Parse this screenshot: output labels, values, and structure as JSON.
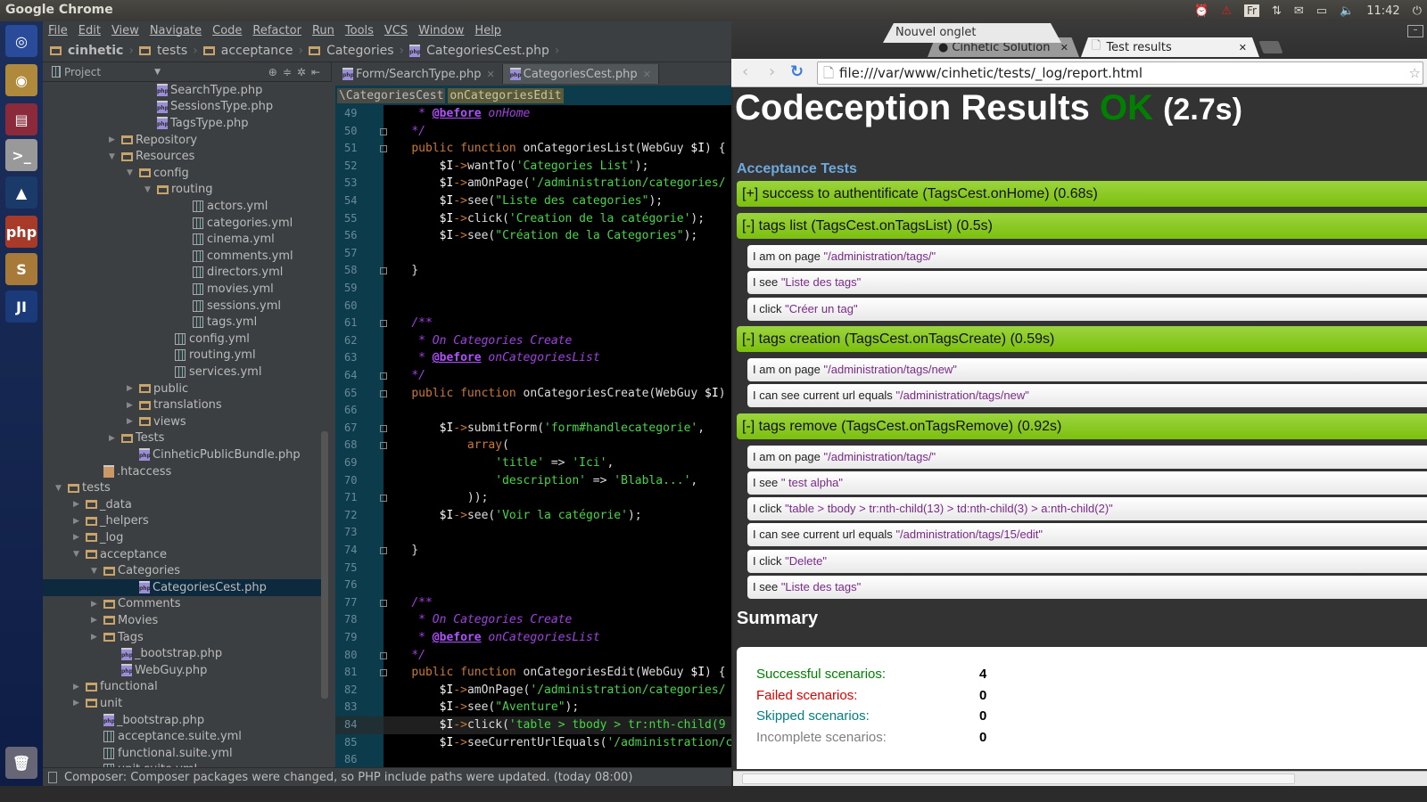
{
  "system": {
    "active_app": "Google Chrome",
    "tray": {
      "keyboard": "Fr",
      "time": "11:42"
    }
  },
  "launcher": {
    "items": [
      {
        "name": "ubuntu-dash",
        "glyph": "◎",
        "color": "#2a4a9a"
      },
      {
        "name": "chrome",
        "glyph": "◉",
        "color": "#b08a3c"
      },
      {
        "name": "file-manager",
        "glyph": "▤",
        "color": "#8a2a3a"
      },
      {
        "name": "terminal",
        "glyph": ">_",
        "color": "#999"
      },
      {
        "name": "inkscape",
        "glyph": "▲",
        "color": "#1a3a6a"
      },
      {
        "name": "phpstorm",
        "glyph": "php",
        "color": "#a83a2a"
      },
      {
        "name": "sublime-text",
        "glyph": "S",
        "color": "#a87a3a"
      },
      {
        "name": "jetbrains",
        "glyph": "JI",
        "color": "#1a3a7a"
      }
    ]
  },
  "ide": {
    "menu": [
      "File",
      "Edit",
      "View",
      "Navigate",
      "Code",
      "Refactor",
      "Run",
      "Tools",
      "VCS",
      "Window",
      "Help"
    ],
    "breadcrumb": [
      "cinhetic",
      "tests",
      "acceptance",
      "Categories",
      "CategoriesCest.php"
    ],
    "project_label": "Project",
    "tree": [
      {
        "label": "SearchType.php",
        "depth": 6,
        "type": "php"
      },
      {
        "label": "SessionsType.php",
        "depth": 6,
        "type": "php"
      },
      {
        "label": "TagsType.php",
        "depth": 6,
        "type": "php"
      },
      {
        "label": "Repository",
        "depth": 4,
        "type": "folder",
        "arrow": "right"
      },
      {
        "label": "Resources",
        "depth": 4,
        "type": "folder",
        "arrow": "down"
      },
      {
        "label": "config",
        "depth": 5,
        "type": "folder",
        "arrow": "down"
      },
      {
        "label": "routing",
        "depth": 6,
        "type": "folder",
        "arrow": "down"
      },
      {
        "label": "actors.yml",
        "depth": 8,
        "type": "yml"
      },
      {
        "label": "categories.yml",
        "depth": 8,
        "type": "yml"
      },
      {
        "label": "cinema.yml",
        "depth": 8,
        "type": "yml"
      },
      {
        "label": "comments.yml",
        "depth": 8,
        "type": "yml"
      },
      {
        "label": "directors.yml",
        "depth": 8,
        "type": "yml"
      },
      {
        "label": "movies.yml",
        "depth": 8,
        "type": "yml"
      },
      {
        "label": "sessions.yml",
        "depth": 8,
        "type": "yml"
      },
      {
        "label": "tags.yml",
        "depth": 8,
        "type": "yml"
      },
      {
        "label": "config.yml",
        "depth": 7,
        "type": "yml"
      },
      {
        "label": "routing.yml",
        "depth": 7,
        "type": "yml"
      },
      {
        "label": "services.yml",
        "depth": 7,
        "type": "yml"
      },
      {
        "label": "public",
        "depth": 5,
        "type": "folder",
        "arrow": "right"
      },
      {
        "label": "translations",
        "depth": 5,
        "type": "folder",
        "arrow": "right"
      },
      {
        "label": "views",
        "depth": 5,
        "type": "folder",
        "arrow": "right"
      },
      {
        "label": "Tests",
        "depth": 4,
        "type": "folder",
        "arrow": "right"
      },
      {
        "label": "CinheticPublicBundle.php",
        "depth": 5,
        "type": "php"
      },
      {
        "label": ".htaccess",
        "depth": 3,
        "type": "file"
      },
      {
        "label": "tests",
        "depth": 1,
        "type": "folder",
        "arrow": "down"
      },
      {
        "label": "_data",
        "depth": 2,
        "type": "folder",
        "arrow": "right"
      },
      {
        "label": "_helpers",
        "depth": 2,
        "type": "folder",
        "arrow": "right"
      },
      {
        "label": "_log",
        "depth": 2,
        "type": "folder",
        "arrow": "right"
      },
      {
        "label": "acceptance",
        "depth": 2,
        "type": "folder",
        "arrow": "down"
      },
      {
        "label": "Categories",
        "depth": 3,
        "type": "folder",
        "arrow": "down"
      },
      {
        "label": "CategoriesCest.php",
        "depth": 5,
        "type": "php",
        "selected": true
      },
      {
        "label": "Comments",
        "depth": 3,
        "type": "folder",
        "arrow": "right"
      },
      {
        "label": "Movies",
        "depth": 3,
        "type": "folder",
        "arrow": "right"
      },
      {
        "label": "Tags",
        "depth": 3,
        "type": "folder",
        "arrow": "right"
      },
      {
        "label": "_bootstrap.php",
        "depth": 4,
        "type": "php"
      },
      {
        "label": "WebGuy.php",
        "depth": 4,
        "type": "php"
      },
      {
        "label": "functional",
        "depth": 2,
        "type": "folder",
        "arrow": "right"
      },
      {
        "label": "unit",
        "depth": 2,
        "type": "folder",
        "arrow": "right"
      },
      {
        "label": "_bootstrap.php",
        "depth": 3,
        "type": "php"
      },
      {
        "label": "acceptance.suite.yml",
        "depth": 3,
        "type": "yml"
      },
      {
        "label": "functional.suite.yml",
        "depth": 3,
        "type": "yml"
      },
      {
        "label": "unit.suite.yml",
        "depth": 3,
        "type": "yml"
      }
    ],
    "editor_tabs": [
      {
        "label": "Form/SearchType.php",
        "active": false
      },
      {
        "label": "CategoriesCest.php",
        "active": true
      }
    ],
    "code_breadcrumb": [
      "\\CategoriesCest",
      "onCategoriesEdit"
    ],
    "code_lines": [
      {
        "n": 49,
        "html": "     <span class='cm'>* </span><span class='tag'>@before</span><span class='cm'> onHome</span>"
      },
      {
        "n": 50,
        "html": "    <span class='cm'>*/</span>"
      },
      {
        "n": 51,
        "html": "    <span class='kw'>public function</span> onCategoriesList(WebGuy <span class='var'>$I</span>) {"
      },
      {
        "n": 52,
        "html": "        <span class='var'>$I</span><span class='arr'>-&gt;</span>wantTo(<span class='str'>'Categories List'</span>);"
      },
      {
        "n": 53,
        "html": "        <span class='var'>$I</span><span class='arr'>-&gt;</span>amOnPage(<span class='str'>'/administration/categories/</span>"
      },
      {
        "n": 54,
        "html": "        <span class='var'>$I</span><span class='arr'>-&gt;</span>see(<span class='str'>\"Liste des categories\"</span>);"
      },
      {
        "n": 55,
        "html": "        <span class='var'>$I</span><span class='arr'>-&gt;</span>click(<span class='str'>'Creation de la catégorie'</span>);"
      },
      {
        "n": 56,
        "html": "        <span class='var'>$I</span><span class='arr'>-&gt;</span>see(<span class='str'>\"Création de la Categories\"</span>);"
      },
      {
        "n": 57,
        "html": ""
      },
      {
        "n": 58,
        "html": "    }"
      },
      {
        "n": 59,
        "html": ""
      },
      {
        "n": 60,
        "html": ""
      },
      {
        "n": 61,
        "html": "    <span class='cm'>/**</span>"
      },
      {
        "n": 62,
        "html": "     <span class='cm'>* On Categories Create</span>"
      },
      {
        "n": 63,
        "html": "     <span class='cm'>* </span><span class='tag'>@before</span><span class='cm'> onCategoriesList</span>"
      },
      {
        "n": 64,
        "html": "    <span class='cm'>*/</span>"
      },
      {
        "n": 65,
        "html": "    <span class='kw'>public function</span> onCategoriesCreate(WebGuy <span class='var'>$I</span>)"
      },
      {
        "n": 66,
        "html": ""
      },
      {
        "n": 67,
        "html": "        <span class='var'>$I</span><span class='arr'>-&gt;</span>submitForm(<span class='str'>'form#handlecategorie'</span>,"
      },
      {
        "n": 68,
        "html": "            <span class='kw'>array</span>("
      },
      {
        "n": 69,
        "html": "                <span class='str'>'title'</span> =&gt; <span class='str'>'Ici'</span>,"
      },
      {
        "n": 70,
        "html": "                <span class='str'>'description'</span> =&gt; <span class='str'>'Blabla...'</span>,"
      },
      {
        "n": 71,
        "html": "            ));"
      },
      {
        "n": 72,
        "html": "        <span class='var'>$I</span><span class='arr'>-&gt;</span>see(<span class='str'>'Voir la catégorie'</span>);"
      },
      {
        "n": 73,
        "html": ""
      },
      {
        "n": 74,
        "html": "    }"
      },
      {
        "n": 75,
        "html": ""
      },
      {
        "n": 76,
        "html": ""
      },
      {
        "n": 77,
        "html": "    <span class='cm'>/**</span>"
      },
      {
        "n": 78,
        "html": "     <span class='cm'>* On Categories Create</span>"
      },
      {
        "n": 79,
        "html": "     <span class='cm'>* </span><span class='tag'>@before</span><span class='cm'> onCategoriesList</span>"
      },
      {
        "n": 80,
        "html": "    <span class='cm'>*/</span>"
      },
      {
        "n": 81,
        "html": "    <span class='kw'>public function</span> onCategoriesEdit(WebGuy <span class='var'>$I</span>) {"
      },
      {
        "n": 82,
        "html": "        <span class='var'>$I</span><span class='arr'>-&gt;</span>amOnPage(<span class='str'>'/administration/categories/</span>"
      },
      {
        "n": 83,
        "html": "        <span class='var'>$I</span><span class='arr'>-&gt;</span>see(<span class='str'>\"Aventure\"</span>);"
      },
      {
        "n": 84,
        "html": "        <span class='var'>$I</span><span class='arr'>-&gt;</span>click(<span class='str'>'table &gt; tbody &gt; tr:nth-child(9</span>",
        "current": true
      },
      {
        "n": 85,
        "html": "        <span class='var'>$I</span><span class='arr'>-&gt;</span>seeCurrentUrlEquals(<span class='str'>'/administration/c</span>"
      },
      {
        "n": 86,
        "html": ""
      }
    ],
    "status_message": "Composer: Composer packages were changed, so PHP include paths were updated. (today 08:00)"
  },
  "browser": {
    "tabs": [
      {
        "label": "Cinhetic Solution",
        "active": false
      },
      {
        "label": "Test results",
        "active": true
      }
    ],
    "new_tab_tooltip": "Nouvel onglet",
    "url": "file:///var/www/cinhetic/tests/_log/report.html",
    "report": {
      "title": "Codeception Results",
      "status": "OK",
      "duration": "(2.7s)",
      "suite": "Acceptance Tests",
      "scenarios": [
        {
          "label": "[+] success to authentificate (TagsCest.onHome) (0.68s)",
          "steps": []
        },
        {
          "label": "[-] tags list (TagsCest.onTagsList) (0.5s)",
          "steps": [
            {
              "action": "I am on page",
              "arg": "\"/administration/tags/\""
            },
            {
              "action": "I see",
              "arg": "\"Liste des tags\""
            },
            {
              "action": "I click",
              "arg": "\"Créer un tag\""
            }
          ]
        },
        {
          "label": "[-] tags creation (TagsCest.onTagsCreate) (0.59s)",
          "steps": [
            {
              "action": "I am on page",
              "arg": "\"/administration/tags/new\""
            },
            {
              "action": "I can see current url equals",
              "arg": "\"/administration/tags/new\""
            }
          ]
        },
        {
          "label": "[-] tags remove (TagsCest.onTagsRemove) (0.92s)",
          "steps": [
            {
              "action": "I am on page",
              "arg": "\"/administration/tags/\""
            },
            {
              "action": "I see",
              "arg": "\" test alpha\""
            },
            {
              "action": "I click",
              "arg": "\"table > tbody > tr:nth-child(13) > td:nth-child(3) > a:nth-child(2)\""
            },
            {
              "action": "I can see current url equals",
              "arg": "\"/administration/tags/15/edit\""
            },
            {
              "action": "I click",
              "arg": "\"Delete\""
            },
            {
              "action": "I see",
              "arg": "\"Liste des tags\""
            }
          ]
        }
      ],
      "summary_title": "Summary",
      "summary": [
        {
          "label": "Successful scenarios:",
          "value": "4",
          "color": "#008000"
        },
        {
          "label": "Failed scenarios:",
          "value": "0",
          "color": "#e00000"
        },
        {
          "label": "Skipped scenarios:",
          "value": "0",
          "color": "#008080"
        },
        {
          "label": "Incomplete scenarios:",
          "value": "0",
          "color": "#808080"
        }
      ]
    }
  }
}
